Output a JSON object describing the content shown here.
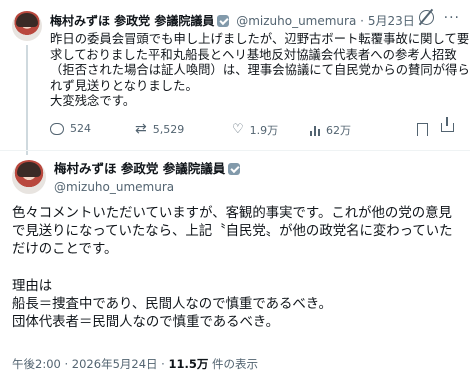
{
  "tweet1": {
    "author_name": "梅村みずほ 参政党 参議院議員",
    "handle": "@mizuho_umemura",
    "separator": "·",
    "date": "5月23日",
    "lines": [
      "昨日の委員会冒頭でも申し上げましたが、辺野古ボート転覆事故に関して要",
      "求しておりました平和丸船長とヘリ基地反対協議会代表者への参考人招致",
      "（拒否された場合は証人喚問）は、理事会協議にて自民党からの賛同が得ら",
      "れず見送りとなりました。",
      "大変残念です。"
    ],
    "stats": {
      "replies": "524",
      "reposts": "5,529",
      "likes": "1.9万",
      "views": "62万"
    }
  },
  "tweet2": {
    "author_name": "梅村みずほ 参政党 参議院議員",
    "handle": "@mizuho_umemura",
    "lines": [
      "色々コメントいただいていますが、客観的事実です。これが他の党の意見",
      "で見送りになっていたなら、上記〝自民党〟が他の政党名に変わっていた",
      "だけのことです。",
      "",
      "理由は",
      "船長＝捜査中であり、民間人なので慎重であるべき。",
      "団体代表者＝民間人なので慎重であるべき。"
    ],
    "time": "午後2:00",
    "date": "2026年5月24日",
    "views_count": "11.5万",
    "views_label": "件の表示"
  },
  "icons": {
    "verified": "verified-badge-icon",
    "grok": "grok-icon",
    "more": "more-icon",
    "reply": "reply-icon",
    "repost": "repost-icon",
    "like": "heart-icon",
    "views": "views-icon",
    "bookmark": "bookmark-icon",
    "share": "share-icon"
  }
}
